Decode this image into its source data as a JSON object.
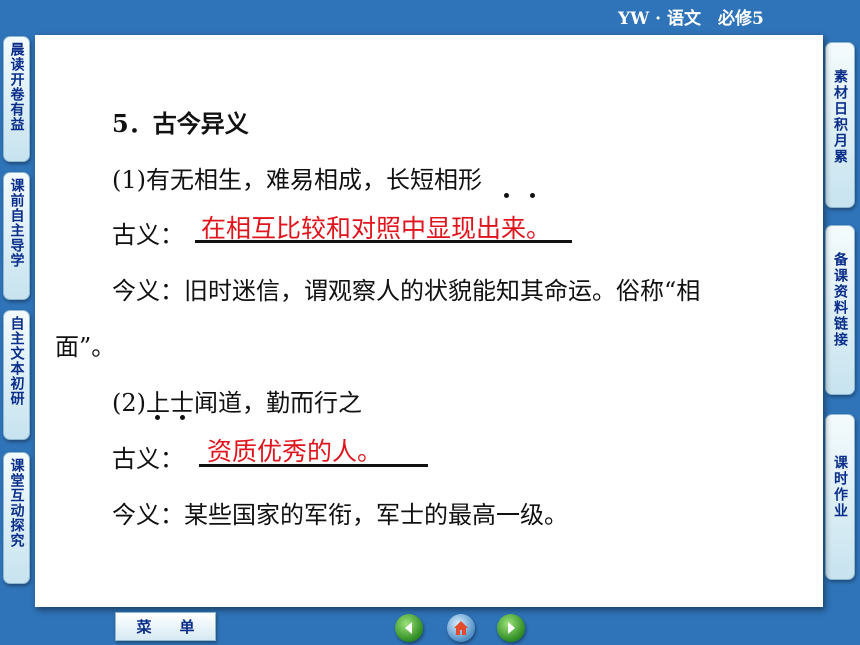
{
  "header": {
    "label": "YW · 语文　必修5"
  },
  "left_nav": [
    {
      "label": "晨读开卷有益"
    },
    {
      "label": "课前自主导学"
    },
    {
      "label": "自主文本初研"
    },
    {
      "label": "课堂互动探究"
    }
  ],
  "right_nav": [
    {
      "label": "素材日积月累"
    },
    {
      "label": "备课资料链接"
    },
    {
      "label": "课时作业"
    }
  ],
  "content": {
    "heading": "5．古今异义",
    "item1": {
      "sentence": "(1)有无相生，难易相成，长短相形",
      "ancient_prefix": "古义：",
      "ancient_answer": "在相互比较和对照中显现出来。",
      "modern_line1": "今义：旧时迷信，谓观察人的状貌能知其命运。俗称“相",
      "modern_line2": "面”。"
    },
    "item2": {
      "sentence": "(2)上士闻道，勤而行之",
      "ancient_prefix": "古义：",
      "ancient_answer": "资质优秀的人。",
      "modern": "今义：某些国家的军衔，军士的最高一级。"
    }
  },
  "footer": {
    "menu_label": "菜单",
    "buttons": [
      {
        "icon": "back-arrow-icon"
      },
      {
        "icon": "home-icon"
      },
      {
        "icon": "forward-arrow-icon"
      }
    ]
  },
  "colors": {
    "background": "#2f73b8",
    "answer": "#e0141c",
    "nav_text": "#0b2e8a"
  }
}
